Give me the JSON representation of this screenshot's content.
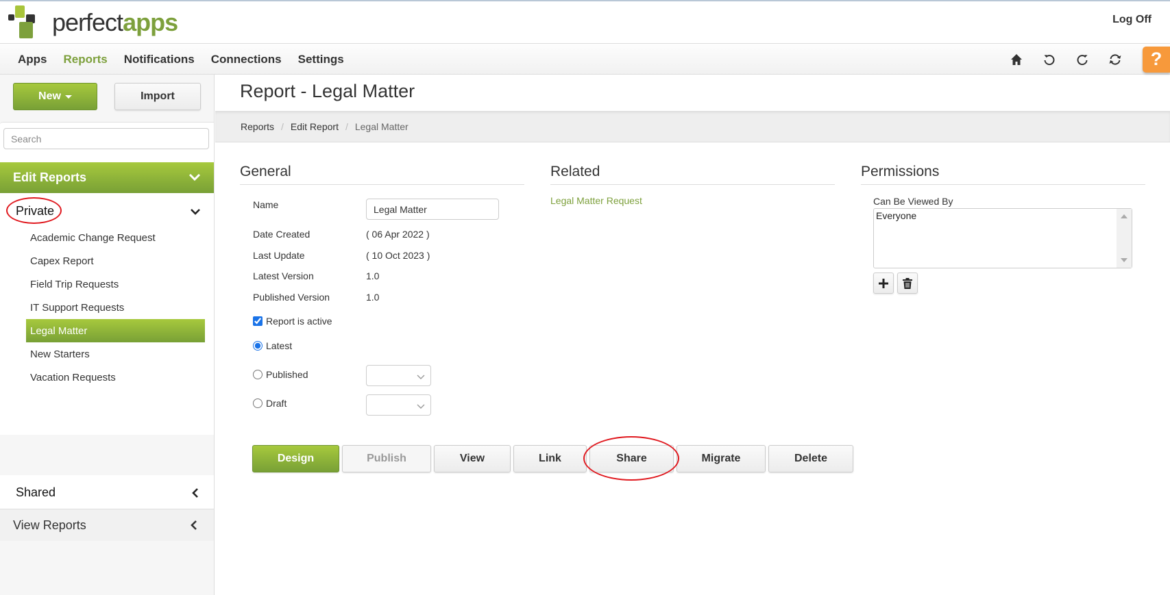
{
  "header": {
    "logo": {
      "word1": "perfect",
      "word2": "apps"
    },
    "logoff_label": "Log Off"
  },
  "nav": {
    "items": [
      {
        "label": "Apps",
        "active": false
      },
      {
        "label": "Reports",
        "active": true
      },
      {
        "label": "Notifications",
        "active": false
      },
      {
        "label": "Connections",
        "active": false
      },
      {
        "label": "Settings",
        "active": false
      }
    ],
    "icons": [
      "home-icon",
      "undo-icon",
      "redo-icon",
      "refresh-icon"
    ],
    "help_label": "?"
  },
  "sidebar": {
    "new_label": "New",
    "import_label": "Import",
    "search_placeholder": "Search",
    "edit_reports_label": "Edit Reports",
    "private_label": "Private",
    "reports": [
      {
        "label": "Academic Change Request",
        "active": false
      },
      {
        "label": "Capex Report",
        "active": false
      },
      {
        "label": "Field Trip Requests",
        "active": false
      },
      {
        "label": "IT Support Requests",
        "active": false
      },
      {
        "label": "Legal Matter",
        "active": true
      },
      {
        "label": "New Starters",
        "active": false
      },
      {
        "label": "Vacation Requests",
        "active": false
      }
    ],
    "shared_label": "Shared",
    "view_reports_label": "View Reports"
  },
  "main": {
    "title": "Report - Legal Matter",
    "breadcrumb": [
      "Reports",
      "Edit Report",
      "Legal Matter"
    ],
    "general": {
      "title": "General",
      "name_label": "Name",
      "name_value": "Legal Matter",
      "date_created_label": "Date Created",
      "date_created_value": "( 06 Apr 2022 )",
      "last_update_label": "Last Update",
      "last_update_value": "( 10 Oct 2023 )",
      "latest_version_label": "Latest Version",
      "latest_version_value": "1.0",
      "published_version_label": "Published Version",
      "published_version_value": "1.0",
      "active_label": "Report is active",
      "active_checked": true,
      "version_options": [
        {
          "label": "Latest",
          "selected": true
        },
        {
          "label": "Published",
          "selected": false
        },
        {
          "label": "Draft",
          "selected": false
        }
      ],
      "published_select_value": "",
      "draft_select_value": ""
    },
    "related": {
      "title": "Related",
      "links": [
        "Legal Matter Request"
      ]
    },
    "permissions": {
      "title": "Permissions",
      "viewed_by_label": "Can Be Viewed By",
      "viewed_by": [
        "Everyone"
      ]
    },
    "actions": [
      {
        "label": "Design",
        "style": "primary"
      },
      {
        "label": "Publish",
        "style": "disabled"
      },
      {
        "label": "View",
        "style": "default"
      },
      {
        "label": "Link",
        "style": "default"
      },
      {
        "label": "Share",
        "style": "default",
        "highlighted": true
      },
      {
        "label": "Migrate",
        "style": "default"
      },
      {
        "label": "Delete",
        "style": "default"
      }
    ]
  },
  "colors": {
    "brand_green": "#7da03c",
    "brand_green_light": "#a7c93d",
    "help_orange": "#f7993b",
    "annotation_red": "#e0191f"
  }
}
